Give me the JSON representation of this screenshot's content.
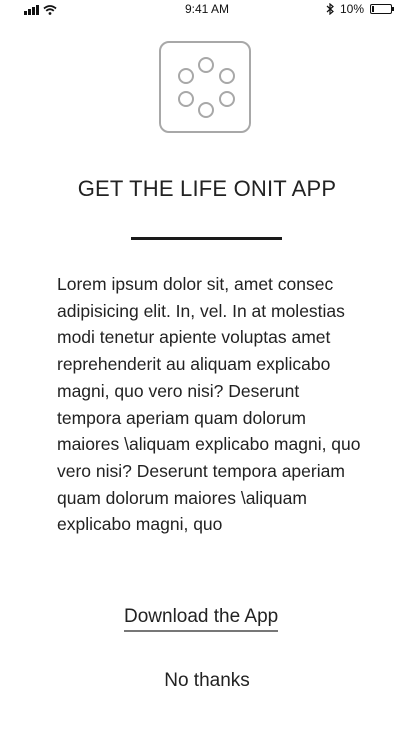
{
  "status_bar": {
    "time": "9:41 AM",
    "battery_percent": "10%",
    "icons": [
      "signal-icon",
      "wifi-icon",
      "bluetooth-icon",
      "battery-icon"
    ]
  },
  "app_icon": {
    "icon": "circle-ring-icon"
  },
  "header": {
    "title": "GET THE LIFE ONIT APP"
  },
  "main": {
    "body_text": "Lorem ipsum dolor sit, amet consec adipisicing elit. In, vel. In at molestias modi tenetur apiente voluptas amet reprehenderit au aliquam explicabo magni, quo vero nisi? Deserunt tempora aperiam quam dolorum maiores \\aliquam explicabo magni, quo vero nisi? Deserunt tempora aperiam quam dolorum maiores \\aliquam explicabo magni, quo"
  },
  "actions": {
    "download_label": "Download the App",
    "dismiss_label": "No thanks"
  },
  "colors": {
    "text": "#222222",
    "icon_border": "#a8a8a8",
    "divider": "#1a1a1a",
    "link_underline": "#777777"
  }
}
